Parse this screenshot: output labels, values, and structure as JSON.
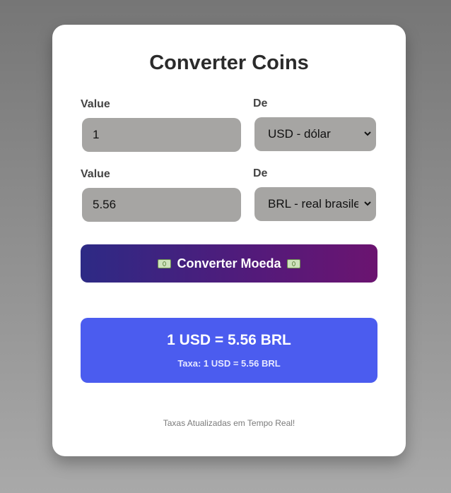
{
  "title": "Converter Coins",
  "row1": {
    "value_label": "Value",
    "value": "1",
    "currency_label": "De",
    "currency": "USD - dólar"
  },
  "row2": {
    "value_label": "Value",
    "value": "5.56",
    "currency_label": "De",
    "currency": "BRL - real brasile"
  },
  "convert_button": {
    "label": "Converter Moeda",
    "icon": "money-bill-icon"
  },
  "result": {
    "main": "1 USD = 5.56 BRL",
    "rate": "Taxa: 1 USD = 5.56 BRL"
  },
  "footer": "Taxas Atualizadas em Tempo Real!",
  "colors": {
    "result_bg": "#4b5cef",
    "button_gradient_start": "#2d2a85",
    "button_gradient_end": "#6b1470",
    "field_bg": "#a6a5a3"
  }
}
